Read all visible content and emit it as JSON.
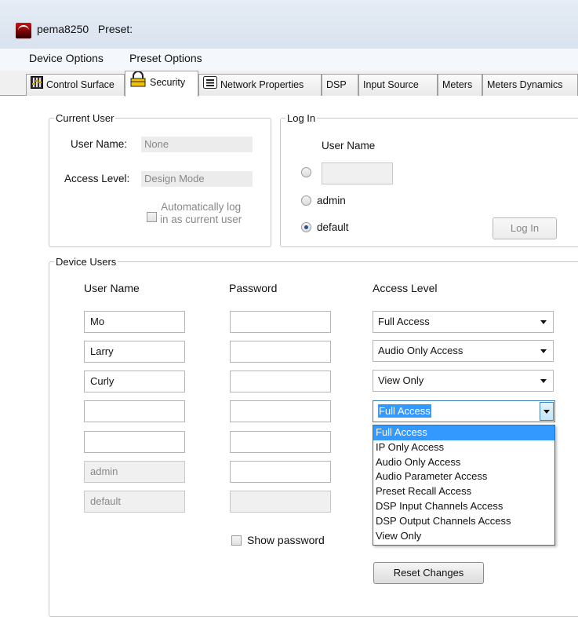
{
  "window": {
    "device": "pema8250",
    "preset_label": "Preset:"
  },
  "menu": [
    "Device Options",
    "Preset Options"
  ],
  "tabs": [
    {
      "label": "Control Surface",
      "icon": "control-surface-icon"
    },
    {
      "label": "Security",
      "icon": "lock-icon"
    },
    {
      "label": "Network Properties",
      "icon": "network-icon"
    },
    {
      "label": "DSP"
    },
    {
      "label": "Input Source"
    },
    {
      "label": "Meters"
    },
    {
      "label": "Meters Dynamics"
    }
  ],
  "current_user": {
    "legend": "Current User",
    "user_name_label": "User Name:",
    "user_name_value": "None",
    "access_level_label": "Access Level:",
    "access_level_value": "Design Mode",
    "auto_log_line1": "Automatically log",
    "auto_log_line2": "in as current user"
  },
  "login": {
    "legend": "Log In",
    "user_name_header": "User Name",
    "options": [
      "",
      "admin",
      "default"
    ],
    "selected": "default",
    "button": "Log In"
  },
  "device_users": {
    "legend": "Device Users",
    "col_user": "User Name",
    "col_password": "Password",
    "col_access": "Access Level",
    "rows": [
      {
        "name": "Mo",
        "access": "Full Access"
      },
      {
        "name": "Larry",
        "access": "Audio Only Access"
      },
      {
        "name": "Curly",
        "access": "View Only"
      },
      {
        "name": "",
        "access": "Full Access"
      },
      {
        "name": ""
      },
      {
        "name": "admin"
      },
      {
        "name": "default"
      }
    ],
    "show_password": "Show password",
    "reset_button": "Reset Changes"
  },
  "dropdown_options": [
    "Full Access",
    "IP Only Access",
    "Audio Only Access",
    "Audio Parameter Access",
    "Preset Recall Access",
    "DSP Input Channels Access",
    "DSP Output Channels Access",
    "View Only"
  ],
  "colors": {
    "selection": "#3399ff",
    "radio_on": "#2a4f86",
    "brand": "#b01010"
  }
}
